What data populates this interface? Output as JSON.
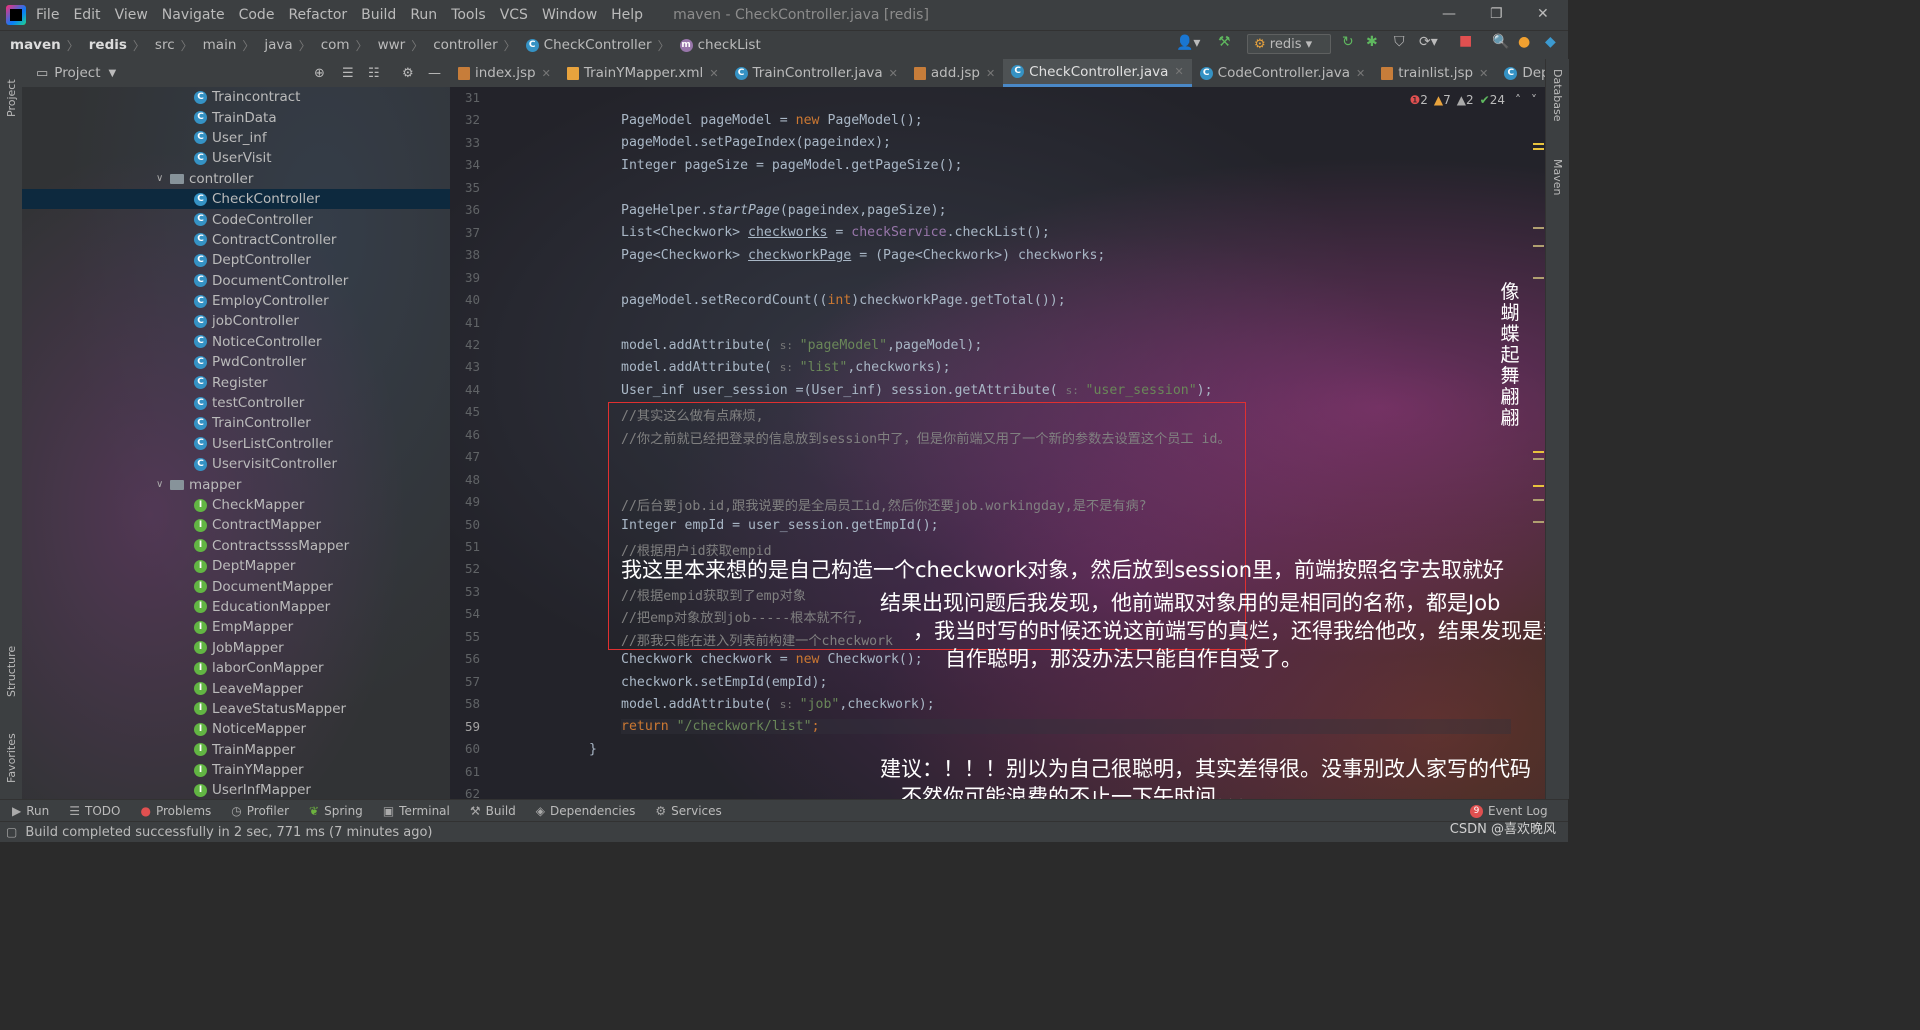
{
  "menubar": {
    "items": [
      "File",
      "Edit",
      "View",
      "Navigate",
      "Code",
      "Refactor",
      "Build",
      "Run",
      "Tools",
      "VCS",
      "Window",
      "Help"
    ],
    "window_title": "maven - CheckController.java [redis]"
  },
  "breadcrumbs": [
    "maven",
    "redis",
    "src",
    "main",
    "java",
    "com",
    "wwr",
    "controller",
    "CheckController",
    "checkList"
  ],
  "toolbar": {
    "run_config": "redis"
  },
  "project_panel": {
    "title": "Project",
    "tree": [
      {
        "label": "Traincontract",
        "type": "class",
        "indent": 1
      },
      {
        "label": "TrainData",
        "type": "class",
        "indent": 1
      },
      {
        "label": "User_inf",
        "type": "class",
        "indent": 1
      },
      {
        "label": "UserVisit",
        "type": "class",
        "indent": 1
      },
      {
        "label": "controller",
        "type": "folder",
        "indent": 0
      },
      {
        "label": "CheckController",
        "type": "class",
        "indent": 1,
        "selected": true
      },
      {
        "label": "CodeController",
        "type": "class",
        "indent": 1
      },
      {
        "label": "ContractController",
        "type": "class",
        "indent": 1
      },
      {
        "label": "DeptController",
        "type": "class",
        "indent": 1
      },
      {
        "label": "DocumentController",
        "type": "class",
        "indent": 1
      },
      {
        "label": "EmployController",
        "type": "class",
        "indent": 1
      },
      {
        "label": "jobController",
        "type": "class",
        "indent": 1
      },
      {
        "label": "NoticeController",
        "type": "class",
        "indent": 1
      },
      {
        "label": "PwdController",
        "type": "class",
        "indent": 1
      },
      {
        "label": "Register",
        "type": "class",
        "indent": 1
      },
      {
        "label": "testController",
        "type": "class",
        "indent": 1
      },
      {
        "label": "TrainController",
        "type": "class",
        "indent": 1
      },
      {
        "label": "UserListController",
        "type": "class",
        "indent": 1
      },
      {
        "label": "UservisitController",
        "type": "class",
        "indent": 1
      },
      {
        "label": "mapper",
        "type": "folder",
        "indent": 0
      },
      {
        "label": "CheckMapper",
        "type": "interface",
        "indent": 1
      },
      {
        "label": "ContractMapper",
        "type": "interface",
        "indent": 1
      },
      {
        "label": "ContractssssMapper",
        "type": "interface",
        "indent": 1
      },
      {
        "label": "DeptMapper",
        "type": "interface",
        "indent": 1
      },
      {
        "label": "DocumentMapper",
        "type": "interface",
        "indent": 1
      },
      {
        "label": "EducationMapper",
        "type": "interface",
        "indent": 1
      },
      {
        "label": "EmpMapper",
        "type": "interface",
        "indent": 1
      },
      {
        "label": "JobMapper",
        "type": "interface",
        "indent": 1
      },
      {
        "label": "laborConMapper",
        "type": "interface",
        "indent": 1
      },
      {
        "label": "LeaveMapper",
        "type": "interface",
        "indent": 1
      },
      {
        "label": "LeaveStatusMapper",
        "type": "interface",
        "indent": 1
      },
      {
        "label": "NoticeMapper",
        "type": "interface",
        "indent": 1
      },
      {
        "label": "TrainMapper",
        "type": "interface",
        "indent": 1
      },
      {
        "label": "TrainYMapper",
        "type": "interface",
        "indent": 1
      },
      {
        "label": "UserInfMapper",
        "type": "interface",
        "indent": 1
      }
    ]
  },
  "tabs": [
    {
      "label": "index.jsp",
      "kind": "jsp"
    },
    {
      "label": "TrainYMapper.xml",
      "kind": "xml"
    },
    {
      "label": "TrainController.java",
      "kind": "class"
    },
    {
      "label": "add.jsp",
      "kind": "jsp"
    },
    {
      "label": "CheckController.java",
      "kind": "class",
      "active": true
    },
    {
      "label": "CodeController.java",
      "kind": "class"
    },
    {
      "label": "trainlist.jsp",
      "kind": "jsp"
    },
    {
      "label": "DeptCon",
      "kind": "class"
    }
  ],
  "inspections": {
    "errors": "2",
    "warnings": "7",
    "weak_warnings": "2",
    "ok": "24"
  },
  "line_numbers": [
    "31",
    "32",
    "33",
    "34",
    "35",
    "36",
    "37",
    "38",
    "39",
    "40",
    "41",
    "42",
    "43",
    "44",
    "45",
    "46",
    "47",
    "48",
    "49",
    "50",
    "51",
    "52",
    "53",
    "54",
    "55",
    "56",
    "57",
    "58",
    "59",
    "60",
    "61",
    "62"
  ],
  "code": {
    "l32a": "PageModel pageModel = ",
    "l32b": "new",
    "l32c": " PageModel();",
    "l33": "pageModel.setPageIndex(pageindex);",
    "l34": "Integer pageSize = pageModel.getPageSize();",
    "l36a": "PageHelper.",
    "l36b": "startPage",
    "l36c": "(pageindex,pageSize);",
    "l37a": "List<Checkwork> ",
    "l37b": "checkworks",
    "l37c": " = ",
    "l37d": "checkService",
    "l37e": ".checkList();",
    "l38a": "Page<Checkwork> ",
    "l38b": "checkworkPage",
    "l38c": " = (Page<Checkwork>) checkworks;",
    "l40a": "pageModel.setRecordCount((",
    "l40b": "int",
    "l40c": ")checkworkPage.getTotal());",
    "l42a": "model.addAttribute( ",
    "l42h": "s: ",
    "l42b": "\"pageModel\"",
    "l42c": ",pageModel);",
    "l43a": "model.addAttribute( ",
    "l43h": "s: ",
    "l43b": "\"list\"",
    "l43c": ",checkworks);",
    "l44a": "User_inf user_session =(User_inf) session.getAttribute( ",
    "l44h": "s: ",
    "l44b": "\"user_session\"",
    "l44c": ");",
    "l45": "//其实这么做有点麻烦,",
    "l46": "//你之前就已经把登录的信息放到session中了，但是你前端又用了一个新的参数去设置这个员工 id。",
    "l49": "//后台要job.id,跟我说要的是全局员工id,然后你还要job.workingday,是不是有病?",
    "l50": "Integer empId = user_session.getEmpId();",
    "l51": "//根据用户id获取empid",
    "l53": "//根据empid获取到了emp对象",
    "l54": "//把emp对象放到job-----根本就不行,",
    "l55": "//那我只能在进入列表前构建一个checkwork",
    "l56a": "Checkwork checkwork = ",
    "l56b": "new",
    "l56c": " Checkwork();",
    "l57": "checkwork.setEmpId(empId);",
    "l58a": "model.addAttribute( ",
    "l58h": "s: ",
    "l58b": "\"job\"",
    "l58c": ",checkwork);",
    "l59a": "return",
    "l59b": " \"/checkwork/list\"",
    "l59c": ";",
    "l60": "}"
  },
  "annotations": {
    "a1": "我这里本来想的是自己构造一个checkwork对象，然后放到session里，前端按照名字去取就好",
    "a2": "结果出现问题后我发现，他前端取对象用的是相同的名称，都是Job",
    "a3": "，我当时写的时候还说这前端写的真烂，还得我给他改，结果发现是我",
    "a4": "自作聪明，那没办法只能自作自受了。",
    "a5": "建议：！！！别以为自己很聪明，其实差得很。没事别改人家写的代码",
    "a6": "，不然你可能浪费的不止一下午时间。。。",
    "vertical": "像蝴蝶起舞翩翩"
  },
  "side_tools": {
    "project": "Project",
    "structure": "Structure",
    "favorites": "Favorites",
    "database": "Database",
    "maven": "Maven"
  },
  "bottom_tools": [
    "Run",
    "TODO",
    "Problems",
    "Profiler",
    "Spring",
    "Terminal",
    "Build",
    "Dependencies",
    "Services"
  ],
  "event_log": {
    "count": "9",
    "label": "Event Log"
  },
  "status": {
    "text": "Build completed successfully in 2 sec, 771 ms (7 minutes ago)"
  },
  "watermark": "CSDN @喜欢晚风",
  "colors": {
    "accent": "#4a88c7",
    "keyword": "#cc7832",
    "string": "#6a8759",
    "comment": "#808080",
    "field": "#9876aa",
    "annotation_box": "#e03030"
  }
}
